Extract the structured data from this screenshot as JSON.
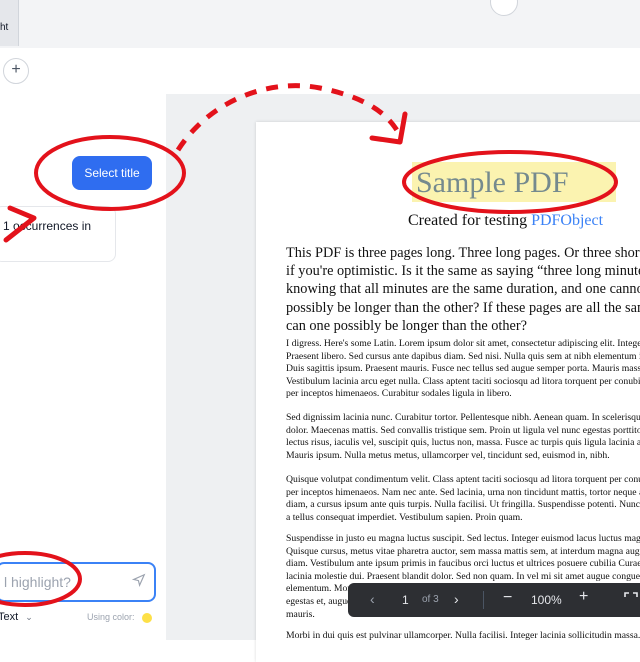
{
  "browser": {
    "tab_fragment": "ht",
    "add_tab_label": "+"
  },
  "left_panel": {
    "select_title_button": "Select title",
    "occurrences_text": "1 occurrences in",
    "chat_placeholder": "l highlight?",
    "mode_label": "Text",
    "using_color_label": "Using color:",
    "highlight_color": "#fde047"
  },
  "pdf": {
    "title": "Sample PDF",
    "subtitle_prefix": "Created for testing ",
    "subtitle_link": "PDFObject",
    "intro": "This PDF is three pages long. Three long pages. Or three short pages if you're optimistic. Is it the same as saying “three long minutes”, knowing that all minutes are the same duration, and one cannot possibly be longer than the other? If these pages are all the same size, can one possibly be longer than the other?",
    "paragraphs": [
      "I digress. Here's some Latin. Lorem ipsum dolor sit amet, consectetur adipiscing elit. Integer nec odio. Praesent libero. Sed cursus ante dapibus diam. Sed nisi. Nulla quis sem at nibh elementum imperdiet. Duis sagittis ipsum. Praesent mauris. Fusce nec tellus sed augue semper porta. Mauris massa. Vestibulum lacinia arcu eget nulla. Class aptent taciti sociosqu ad litora torquent per conubia nostra, per inceptos himenaeos. Curabitur sodales ligula in libero.",
      "Sed dignissim lacinia nunc. Curabitur tortor. Pellentesque nibh. Aenean quam. In scelerisque sem at dolor. Maecenas mattis. Sed convallis tristique sem. Proin ut ligula vel nunc egestas porttitor. Morbi lectus risus, iaculis vel, suscipit quis, luctus non, massa. Fusce ac turpis quis ligula lacinia aliquet. Mauris ipsum. Nulla metus metus, ullamcorper vel, tincidunt sed, euismod in, nibh.",
      "Quisque volutpat condimentum velit. Class aptent taciti sociosqu ad litora torquent per conubia nostra, per inceptos himenaeos. Nam nec ante. Sed lacinia, urna non tincidunt mattis, tortor neque adipiscing diam, a cursus ipsum ante quis turpis. Nulla facilisi. Ut fringilla. Suspendisse potenti. Nunc feugiat mi a tellus consequat imperdiet. Vestibulum sapien. Proin quam.",
      "Suspendisse in justo eu magna luctus suscipit. Sed lectus. Integer euismod lacus luctus magna. Quisque cursus, metus vitae pharetra auctor, sem massa mattis sem, at interdum magna augue eget diam. Vestibulum ante ipsum primis in faucibus orci luctus et ultrices posuere cubilia Curae; Morbi lacinia molestie dui. Praesent blandit dolor. Sed non quam. In vel mi sit amet augue congue elementum. Morbi in ipsum sit amet pede facilisis laoreet. Donec lacus nunc, viverra nec, blandit vel, egestas et, augue. Vestibulum tincidunt malesuada tellus. Ut ultrices ultrices enim. Curabitur sit amet mauris.",
      "Morbi in dui quis est pulvinar ullamcorper. Nulla facilisi. Integer lacinia sollicitudin massa."
    ]
  },
  "pager": {
    "page": "1",
    "of_label": "of 3",
    "zoom": "100%"
  }
}
